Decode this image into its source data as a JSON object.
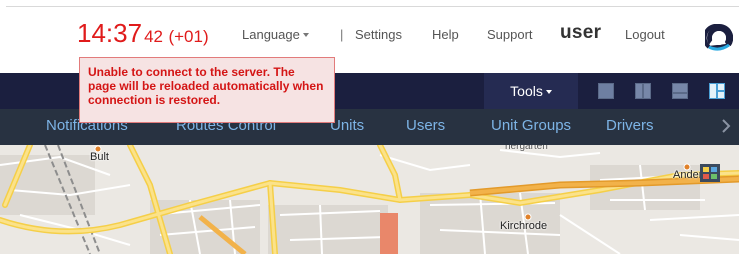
{
  "clock": {
    "time": "14:37",
    "seconds": "42",
    "timezone": "(+01)"
  },
  "header": {
    "language_label": "Language",
    "separator": "|",
    "settings_label": "Settings",
    "help_label": "Help",
    "support_label": "Support",
    "username": "user",
    "logout_label": "Logout"
  },
  "error": {
    "message": "Unable to connect to the server. The page will be reloaded automatically when connection is restored."
  },
  "toolbar": {
    "tools_label": "Tools"
  },
  "menu": {
    "items": [
      {
        "label": "Notifications"
      },
      {
        "label": "Routes Control"
      },
      {
        "label": "Units"
      },
      {
        "label": "Users"
      },
      {
        "label": "Unit Groups"
      },
      {
        "label": "Drivers"
      }
    ]
  },
  "map": {
    "labels": {
      "bult": "Bult",
      "anderten": "Anderten",
      "kirchrode": "Kirchrode",
      "hergarten": "hergarten"
    }
  },
  "colors": {
    "clock": "#e01b1b",
    "toolbar_bg": "#1b1f3f",
    "menubar_bg": "#283241",
    "menu_text": "#7db4e6",
    "error_bg": "#f6e3e3",
    "error_text": "#d41515",
    "road_major": "#fbd85a",
    "road_highway": "#f2a533"
  }
}
